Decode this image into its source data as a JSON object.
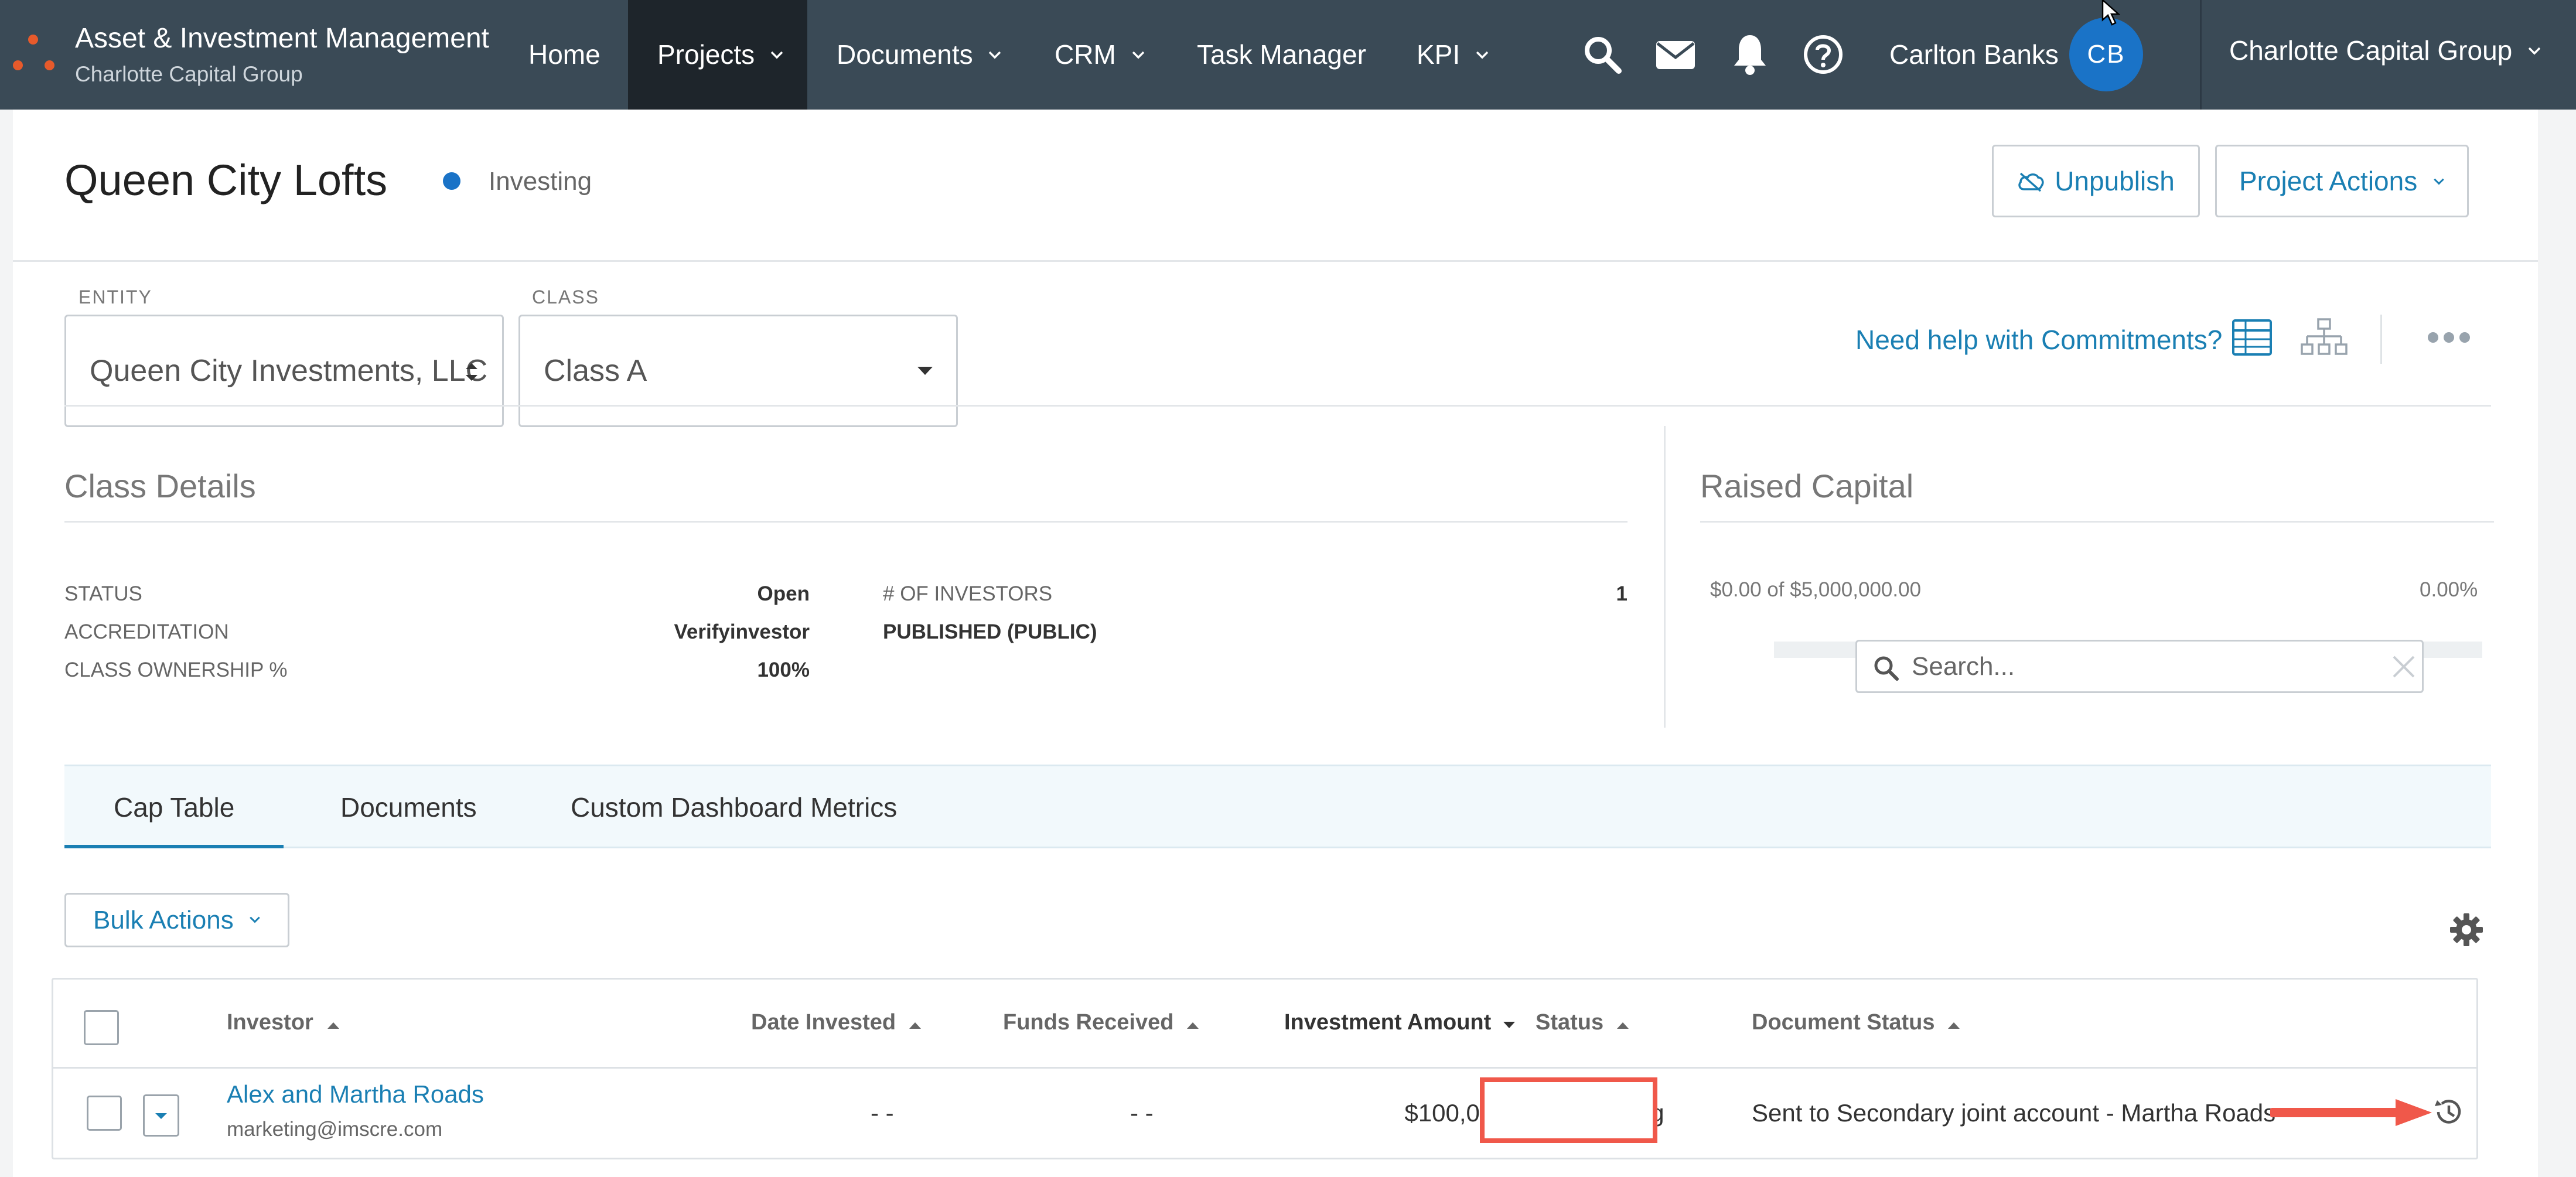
{
  "app": {
    "title": "Asset & Investment Management",
    "org_subtitle": "Charlotte Capital Group",
    "accent_color": "#1a7fb3",
    "nav_bg": "#3a4a56"
  },
  "nav": {
    "items": [
      {
        "label": "Home",
        "dropdown": false
      },
      {
        "label": "Projects",
        "dropdown": true,
        "active": true
      },
      {
        "label": "Documents",
        "dropdown": true
      },
      {
        "label": "CRM",
        "dropdown": true
      },
      {
        "label": "Task Manager",
        "dropdown": false
      },
      {
        "label": "KPI",
        "dropdown": true
      }
    ],
    "icons": [
      "search-icon",
      "mail-icon",
      "bell-icon",
      "help-icon"
    ],
    "user_name": "Carlton Banks",
    "avatar_initials": "CB",
    "org_switcher": "Charlotte Capital Group"
  },
  "header": {
    "title": "Queen City Lofts",
    "status": "Investing",
    "unpublish_label": "Unpublish",
    "project_actions_label": "Project Actions"
  },
  "filters": {
    "entity_label": "ENTITY",
    "entity_value": "Queen City Investments, LLC",
    "class_label": "CLASS",
    "class_value": "Class A",
    "help_link": "Need help with Commitments?"
  },
  "class_details": {
    "title": "Class Details",
    "rows_left": [
      {
        "label": "STATUS",
        "value": "Open"
      },
      {
        "label": "ACCREDITATION",
        "value": "Verifyinvestor"
      },
      {
        "label": "CLASS OWNERSHIP %",
        "value": "100%"
      }
    ],
    "investors_label": "# OF INVESTORS",
    "investors_value": "1",
    "published_label": "PUBLISHED (PUBLIC)"
  },
  "raised_capital": {
    "title": "Raised Capital",
    "summary": "$0.00 of $5,000,000.00",
    "percent_text": "0.00%",
    "progress_fraction": 0.0
  },
  "tabs": [
    {
      "label": "Cap Table",
      "active": true
    },
    {
      "label": "Documents",
      "active": false
    },
    {
      "label": "Custom Dashboard Metrics",
      "active": false
    }
  ],
  "toolbar": {
    "bulk_actions_label": "Bulk Actions",
    "search_placeholder": "Search..."
  },
  "table": {
    "columns": [
      {
        "label": "Investor",
        "sort": "asc"
      },
      {
        "label": "Date Invested",
        "sort": "asc"
      },
      {
        "label": "Funds Received",
        "sort": "asc"
      },
      {
        "label": "Investment Amount",
        "sort": "desc"
      },
      {
        "label": "Status",
        "sort": "asc"
      },
      {
        "label": "Document Status",
        "sort": "asc"
      }
    ],
    "rows": [
      {
        "investor_name": "Alex and Martha Roads",
        "investor_email": "marketing@imscre.com",
        "date_invested": "- -",
        "funds_received": "- -",
        "investment_amount": "$100,000.00",
        "status": "Pending",
        "document_status": "Sent to Secondary joint account - Martha Roads"
      }
    ]
  },
  "annotation": {
    "highlight_color": "#f0584a"
  }
}
